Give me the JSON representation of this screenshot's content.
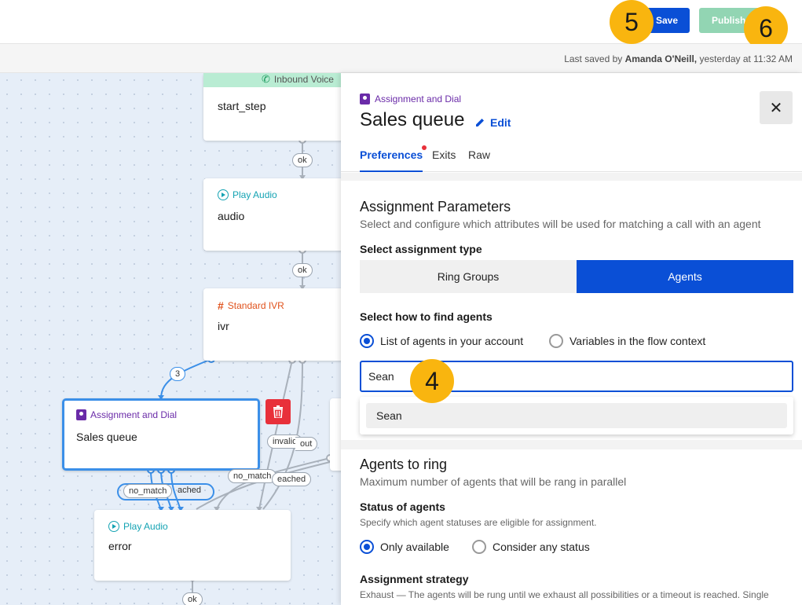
{
  "toolbar": {
    "save_label": "Save",
    "publish_label": "Publish"
  },
  "markers": {
    "m4": "4",
    "m5": "5",
    "m6": "6"
  },
  "saved": {
    "prefix": "Last saved by",
    "user": "Amanda O'Neill,",
    "when": "yesterday at 11:32 AM"
  },
  "canvas": {
    "nodes": {
      "inbound": {
        "type": "Inbound Voice",
        "title": "start_step"
      },
      "audio": {
        "type": "Play Audio",
        "title": "audio"
      },
      "ivr": {
        "type": "Standard IVR",
        "title": "ivr"
      },
      "assign": {
        "type": "Assignment and Dial",
        "title": "Sales queue"
      },
      "error": {
        "type": "Play Audio",
        "title": "error"
      }
    },
    "pills": {
      "ok1": "ok",
      "ok2": "ok",
      "three": "3",
      "invalid": "invalid",
      "out": "out",
      "no_match1": "no_match",
      "reached1": "eached",
      "no_match2": "no_match",
      "reached2": "ached",
      "ok3": "ok"
    }
  },
  "panel": {
    "type": "Assignment and Dial",
    "title": "Sales queue",
    "edit_label": "Edit",
    "tabs": [
      "Preferences",
      "Exits",
      "Raw"
    ],
    "assignment": {
      "heading": "Assignment Parameters",
      "subtitle": "Select and configure which attributes will be used for matching a call with an agent",
      "type_label": "Select assignment type",
      "options": [
        "Ring Groups",
        "Agents"
      ],
      "selected": "Agents"
    },
    "find": {
      "label": "Select how to find agents",
      "radio1": "List of agents in your account",
      "radio2": "Variables in the flow context",
      "input_value": "Sean",
      "suggestion": "Sean"
    },
    "ring": {
      "heading": "Agents to ring",
      "subtitle": "Maximum number of agents that will be rang in parallel"
    },
    "status": {
      "label": "Status of agents",
      "subtitle": "Specify which agent statuses are eligible for assignment.",
      "radio1": "Only available",
      "radio2": "Consider any status"
    },
    "strategy": {
      "label": "Assignment strategy",
      "subtitle": "Exhaust — The agents will be rung until we exhaust all possibilities or a timeout is reached. Single"
    }
  },
  "colors": {
    "primary": "#0a4fd6",
    "publish": "#92d5b3",
    "marker": "#f9b50f",
    "assignment_purple": "#6a2ba8",
    "play_teal": "#14a3b3",
    "ivr_orange": "#e0521c",
    "inbound_green": "#b9ecd3",
    "delete_red": "#e8303a"
  }
}
